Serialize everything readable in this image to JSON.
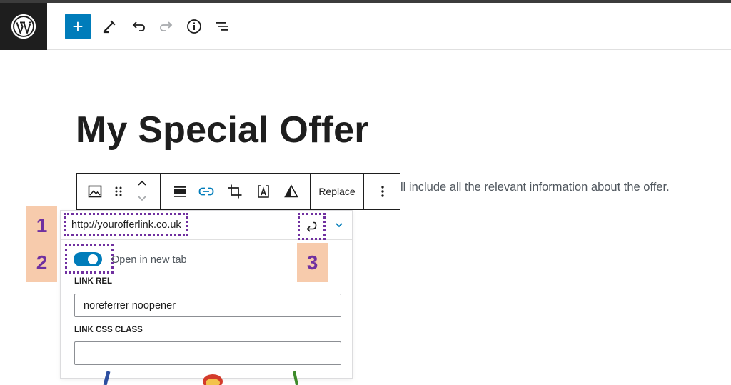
{
  "header": {
    "logo_icon": "wordpress-logo-icon",
    "buttons": [
      {
        "name": "add-block-button",
        "icon": "plus-icon",
        "label": "+"
      },
      {
        "name": "tools-button",
        "icon": "pencil-icon"
      },
      {
        "name": "undo-button",
        "icon": "undo-icon"
      },
      {
        "name": "redo-button",
        "icon": "redo-icon",
        "disabled": true
      },
      {
        "name": "details-button",
        "icon": "info-icon"
      },
      {
        "name": "list-view-button",
        "icon": "list-view-icon"
      }
    ]
  },
  "content": {
    "title": "My Special Offer",
    "paragraph_visible": "ll include all the relevant information about the offer."
  },
  "block_toolbar": {
    "icons": [
      "image-block-icon",
      "drag-handle-icon",
      "move-up-icon",
      "move-down-icon",
      "align-icon",
      "link-icon",
      "crop-icon",
      "text-overlay-icon",
      "duotone-icon",
      "more-options-icon"
    ],
    "replace_label": "Replace"
  },
  "link_popover": {
    "url": "http://yourofferlink.co.uk",
    "open_new_tab_label": "Open in new tab",
    "open_new_tab_checked": true,
    "link_rel_label": "LINK REL",
    "link_rel_value": "noreferrer noopener",
    "link_css_class_label": "LINK CSS CLASS",
    "link_css_class_value": ""
  },
  "callouts": [
    "1",
    "2",
    "3"
  ],
  "colors": {
    "accent": "#007cba",
    "callout_text": "#7030a0",
    "callout_bg": "#f7cbac",
    "dark_chrome": "#1e1e1e"
  }
}
